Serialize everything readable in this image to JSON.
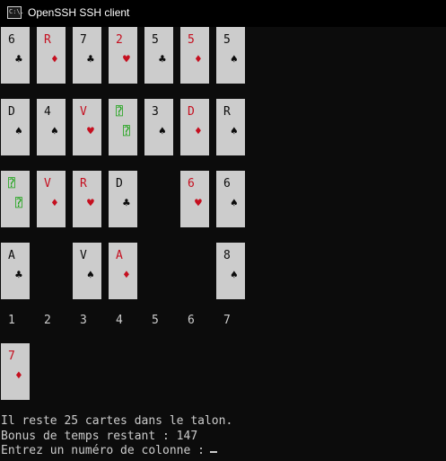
{
  "window": {
    "title": "OpenSSH SSH client",
    "icon": "console-icon",
    "icon_text": "C:\\."
  },
  "colors": {
    "red": "#c50f1f",
    "black": "#0c0c0c",
    "green": "#13a10e",
    "card_bg": "#cccccc",
    "text": "#cccccc"
  },
  "tableau": {
    "rows": [
      [
        {
          "rank": "6",
          "suit": "♣",
          "color": "black"
        },
        {
          "rank": "R",
          "suit": "♦",
          "color": "red"
        },
        {
          "rank": "7",
          "suit": "♣",
          "color": "black"
        },
        {
          "rank": "2",
          "suit": "♥",
          "color": "red"
        },
        {
          "rank": "5",
          "suit": "♣",
          "color": "black"
        },
        {
          "rank": "5",
          "suit": "♦",
          "color": "red"
        },
        {
          "rank": "5",
          "suit": "♠",
          "color": "black"
        }
      ],
      [
        {
          "rank": "D",
          "suit": "♠",
          "color": "black"
        },
        {
          "rank": "4",
          "suit": "♠",
          "color": "black"
        },
        {
          "rank": "V",
          "suit": "♥",
          "color": "red"
        },
        {
          "rank": "⍰",
          "suit": "⍰",
          "color": "green"
        },
        {
          "rank": "3",
          "suit": "♠",
          "color": "black"
        },
        {
          "rank": "D",
          "suit": "♦",
          "color": "red"
        },
        {
          "rank": "R",
          "suit": "♠",
          "color": "black"
        }
      ],
      [
        {
          "rank": "⍰",
          "suit": "⍰",
          "color": "green"
        },
        {
          "rank": "V",
          "suit": "♦",
          "color": "red"
        },
        {
          "rank": "R",
          "suit": "♥",
          "color": "red"
        },
        {
          "rank": "D",
          "suit": "♣",
          "color": "black"
        },
        null,
        {
          "rank": "6",
          "suit": "♥",
          "color": "red"
        },
        {
          "rank": "6",
          "suit": "♠",
          "color": "black"
        }
      ],
      [
        {
          "rank": "A",
          "suit": "♣",
          "color": "black"
        },
        null,
        {
          "rank": "V",
          "suit": "♠",
          "color": "black"
        },
        {
          "rank": "A",
          "suit": "♦",
          "color": "red"
        },
        null,
        null,
        {
          "rank": "8",
          "suit": "♠",
          "color": "black"
        }
      ]
    ]
  },
  "column_labels": [
    "1",
    "2",
    "3",
    "4",
    "5",
    "6",
    "7"
  ],
  "waste_card": {
    "rank": "7",
    "suit": "♦",
    "color": "red"
  },
  "messages": {
    "stock_remaining": "Il reste 25 cartes dans le talon.",
    "time_bonus": "Bonus de temps restant : 147",
    "prompt": "Entrez un numéro de colonne : "
  }
}
